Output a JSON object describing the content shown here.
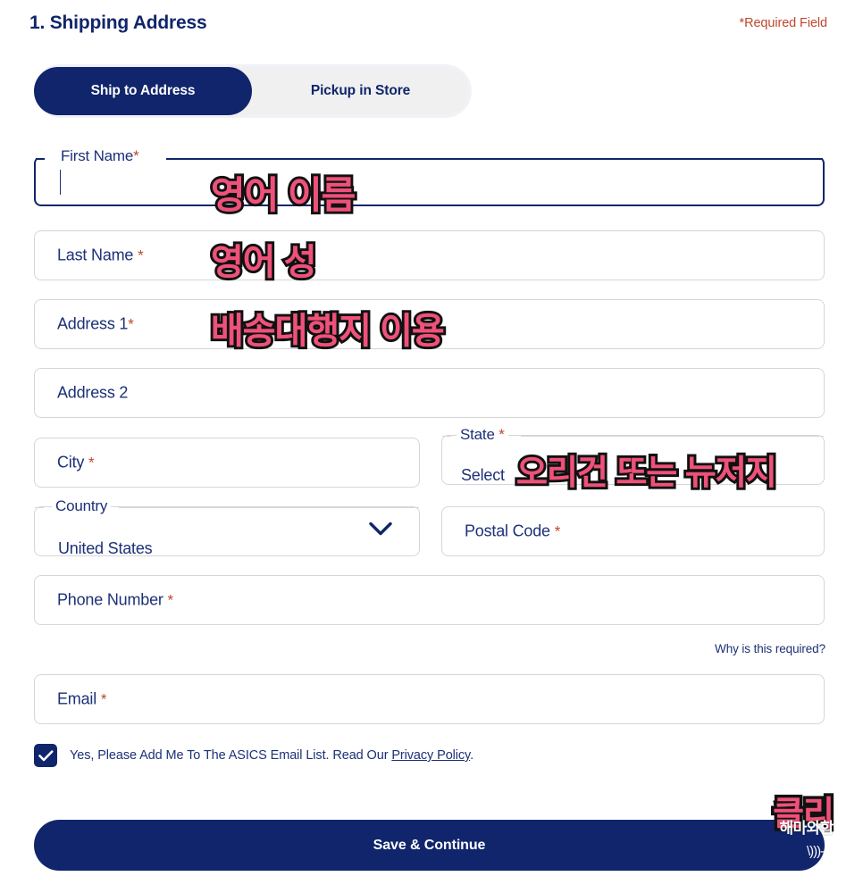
{
  "header": {
    "title": "1. Shipping Address",
    "required_note": "*Required Field"
  },
  "tabs": [
    {
      "label": "Ship to Address",
      "active": true
    },
    {
      "label": "Pickup in Store",
      "active": false
    }
  ],
  "form": {
    "first_name": {
      "label": "First Name",
      "required_mark": "*",
      "value": "",
      "focused": true
    },
    "last_name": {
      "label": "Last Name",
      "required_mark": "*",
      "value": ""
    },
    "address1": {
      "label": "Address 1",
      "required_mark": "*",
      "value": ""
    },
    "address2": {
      "label": "Address 2",
      "required_mark": "",
      "value": ""
    },
    "city": {
      "label": "City",
      "required_mark": "*",
      "value": ""
    },
    "state": {
      "label": "State",
      "required_mark": "*",
      "value": "Select"
    },
    "country": {
      "label": "Country",
      "required_mark": "",
      "value": "United States"
    },
    "postal_code": {
      "label": "Postal Code",
      "required_mark": "*",
      "value": ""
    },
    "phone_number": {
      "label": "Phone Number",
      "required_mark": "*",
      "value": ""
    },
    "email": {
      "label": "Email",
      "required_mark": "*",
      "value": ""
    }
  },
  "why_link": "Why is this required?",
  "newsletter": {
    "checked": true,
    "text_before": "Yes, Please Add Me To The ASICS Email List. Read Our ",
    "link": "Privacy Policy",
    "text_after": "."
  },
  "submit": {
    "label": "Save & Continue"
  },
  "annotations": [
    {
      "id": "first_name_note",
      "text": "영어 이름"
    },
    {
      "id": "last_name_note",
      "text": "영어 성"
    },
    {
      "id": "address1_note",
      "text": "배송대행지 이용"
    },
    {
      "id": "state_note",
      "text": "오리건 또는 뉴저지"
    }
  ],
  "watermark": {
    "main": "클리",
    "sub": "해마와함",
    "decoration": "\\)))-♥"
  },
  "colors": {
    "navy": "#10256B",
    "label_blue": "#1C3177",
    "required_red": "#C0472C",
    "annotation_pink": "#EE5179",
    "annotation_outline": "#111111",
    "field_border": "#D6D6D6",
    "tab_track": "#F0F0F0"
  }
}
